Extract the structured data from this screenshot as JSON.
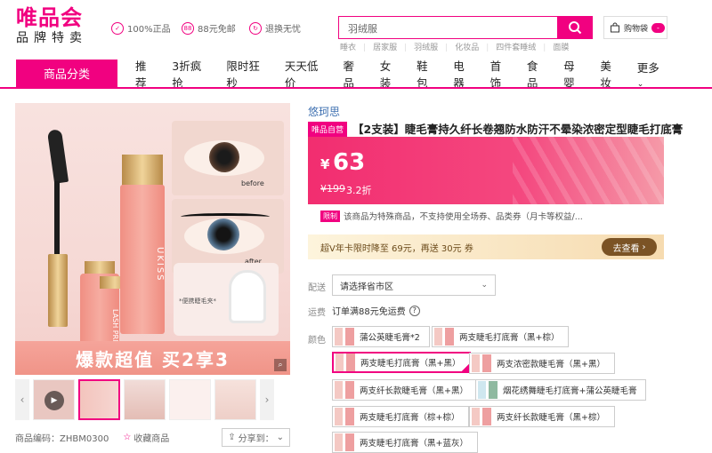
{
  "header": {
    "logo_main": "唯品会",
    "logo_sub": "品牌特卖",
    "promises": [
      {
        "icon": "shield-icon",
        "label": "100%正品"
      },
      {
        "icon": "88-badge-icon",
        "label": "88元免邮"
      },
      {
        "icon": "return-icon",
        "label": "退换无忧"
      }
    ],
    "search": {
      "value": "羽绒服"
    },
    "hot_words": [
      "睡衣",
      "居家服",
      "羽绒服",
      "化妆品",
      "四件套睡绒",
      "面膜"
    ],
    "cart": {
      "label": "购物袋",
      "badge": "-"
    }
  },
  "nav": {
    "category_label": "商品分类",
    "items": [
      "推荐",
      "3折疯抢",
      "限时狂秒",
      "天天低价",
      "奢品",
      "女装",
      "鞋包",
      "电器",
      "首饰",
      "食品",
      "母婴",
      "美妆",
      "更多"
    ]
  },
  "gallery": {
    "banner_text": "爆款超值 买2享3",
    "label_before": "before",
    "label_after": "after",
    "product_text_left": "LASH PRIMER",
    "product_text_right": "UKISS",
    "clip_caption": "*便携睫毛夹*",
    "product_code_label": "商品编码：ZHBM0300",
    "favorite_label": "收藏商品",
    "share_label": "分享到："
  },
  "product": {
    "brand": "悠珂思",
    "self_tag": "唯品自营",
    "title": "【2支装】睫毛膏持久纤长卷翘防水防汗不晕染浓密定型睫毛打底膏",
    "price_symbol": "¥",
    "price": "63",
    "original_price": "¥199",
    "discount": "3.2折",
    "limit_tag": "限制",
    "limit_text": "该商品为特殊商品，不支持使用全场券、品类券（月卡等权益/...",
    "vip_text": "超V年卡限时降至 69元，再送 30元 券",
    "vip_button": "去查看",
    "delivery_label": "配送",
    "delivery_select": "请选择省市区",
    "shipping_label": "运费",
    "shipping_text": "订单满88元免运费",
    "color_label": "颜色",
    "colors": [
      "蒲公英睫毛膏*2",
      "两支睫毛打底膏（黑+棕）",
      "两支睫毛打底膏（黑+黑）",
      "两支浓密款睫毛膏（黑+黑）",
      "两支纤长款睫毛膏（黑+黑）",
      "烟花绣舞睫毛打底膏+蒲公英睫毛膏",
      "两支睫毛打底膏（棕+棕）",
      "两支纤长款睫毛膏（黑+棕）",
      "两支睫毛打底膏（黑+蓝灰）"
    ],
    "selected_color_index": 2
  },
  "colors": {
    "brand_pink": "#f10180",
    "vip_brown": "#7b5325",
    "link_blue": "#3d6fb0"
  }
}
